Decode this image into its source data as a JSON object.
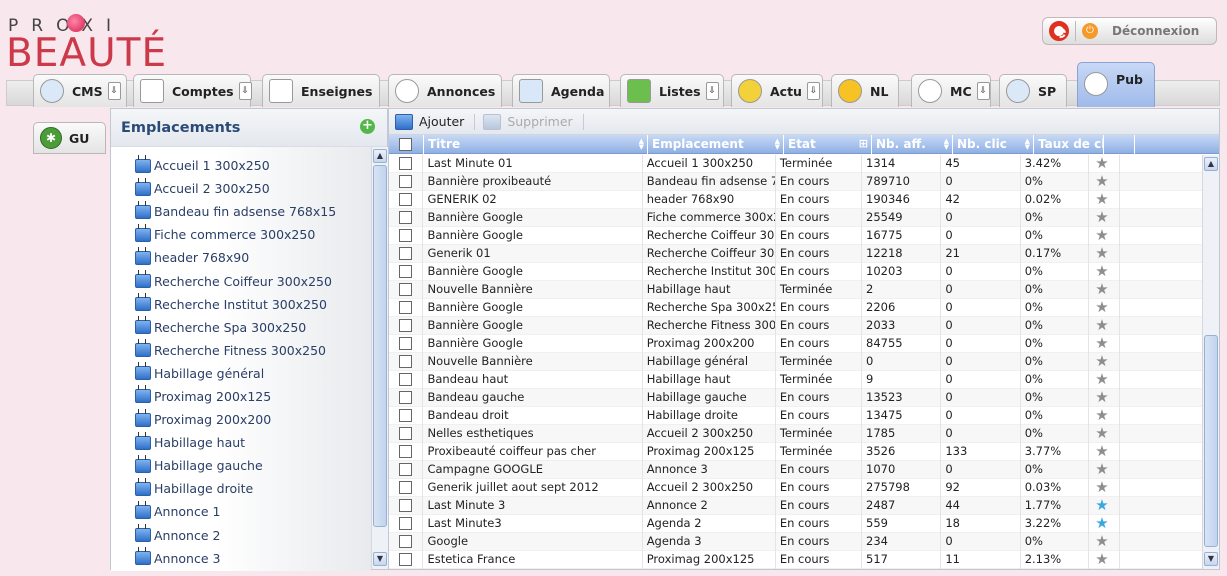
{
  "brand": {
    "top": "PROXI",
    "bottom": "BEAUTÉ"
  },
  "logout": {
    "label": "Déconnexion"
  },
  "tabs": [
    {
      "label": "CMS",
      "icon": "gauge-icon",
      "dropdown": true
    },
    {
      "label": "Comptes",
      "icon": "users-icon",
      "dropdown": true
    },
    {
      "label": "Enseignes",
      "icon": "home-icon",
      "dropdown": false
    },
    {
      "label": "Annonces",
      "icon": "speech-bubble-icon",
      "dropdown": false
    },
    {
      "label": "Agenda",
      "icon": "calendar-icon",
      "dropdown": false
    },
    {
      "label": "Listes",
      "icon": "list-icon",
      "dropdown": true
    },
    {
      "label": "Actu",
      "icon": "info-icon",
      "dropdown": true
    },
    {
      "label": "NL",
      "icon": "envelope-icon",
      "dropdown": false
    },
    {
      "label": "MC",
      "icon": "camera-icon",
      "dropdown": true
    },
    {
      "label": "SP",
      "icon": "gauge-icon",
      "dropdown": false
    },
    {
      "label": "Pub",
      "icon": "wand-icon",
      "dropdown": false
    }
  ],
  "side_tab": {
    "label": "GU"
  },
  "left_panel": {
    "title": "Emplacements",
    "items": [
      "Accueil 1 300x250",
      "Accueil 2 300x250",
      "Bandeau fin adsense 768x15",
      "Fiche commerce 300x250",
      "header 768x90",
      "Recherche Coiffeur 300x250",
      "Recherche Institut 300x250",
      "Recherche Spa 300x250",
      "Recherche Fitness 300x250",
      "Habillage général",
      "Proximag 200x125",
      "Proximag 200x200",
      "Habillage haut",
      "Habillage gauche",
      "Habillage droite",
      "Annonce 1",
      "Annonce 2",
      "Annonce 3"
    ]
  },
  "toolbar": {
    "add_label": "Ajouter",
    "delete_label": "Supprimer"
  },
  "grid": {
    "columns": [
      "Titre",
      "Emplacement",
      "Etat",
      "Nb. aff.",
      "Nb. clic",
      "Taux de cl"
    ],
    "rows": [
      {
        "titre": "Last Minute 01",
        "emplacement": "Accueil 1 300x250",
        "etat": "Terminée",
        "aff": "1314",
        "clic": "45",
        "taux": "3.42%",
        "starred": false
      },
      {
        "titre": "Bannière proxibeauté",
        "emplacement": "Bandeau fin adsense 76",
        "etat": "En cours",
        "aff": "789710",
        "clic": "0",
        "taux": "0%",
        "starred": false
      },
      {
        "titre": "GENERIK 02",
        "emplacement": "header 768x90",
        "etat": "En cours",
        "aff": "190346",
        "clic": "42",
        "taux": "0.02%",
        "starred": false
      },
      {
        "titre": "Bannière Google",
        "emplacement": "Fiche commerce 300x2",
        "etat": "En cours",
        "aff": "25549",
        "clic": "0",
        "taux": "0%",
        "starred": false
      },
      {
        "titre": "Bannière Google",
        "emplacement": "Recherche Coiffeur 300",
        "etat": "En cours",
        "aff": "16775",
        "clic": "0",
        "taux": "0%",
        "starred": false
      },
      {
        "titre": "Generik 01",
        "emplacement": "Recherche Coiffeur 300",
        "etat": "En cours",
        "aff": "12218",
        "clic": "21",
        "taux": "0.17%",
        "starred": false
      },
      {
        "titre": "Bannière Google",
        "emplacement": "Recherche Institut 300x",
        "etat": "En cours",
        "aff": "10203",
        "clic": "0",
        "taux": "0%",
        "starred": false
      },
      {
        "titre": "Nouvelle Bannière",
        "emplacement": "Habillage haut",
        "etat": "Terminée",
        "aff": "2",
        "clic": "0",
        "taux": "0%",
        "starred": false
      },
      {
        "titre": "Bannière Google",
        "emplacement": "Recherche Spa 300x25",
        "etat": "En cours",
        "aff": "2206",
        "clic": "0",
        "taux": "0%",
        "starred": false
      },
      {
        "titre": "Bannière Google",
        "emplacement": "Recherche Fitness 300x",
        "etat": "En cours",
        "aff": "2033",
        "clic": "0",
        "taux": "0%",
        "starred": false
      },
      {
        "titre": "Bannière Google",
        "emplacement": "Proximag 200x200",
        "etat": "En cours",
        "aff": "84755",
        "clic": "0",
        "taux": "0%",
        "starred": false
      },
      {
        "titre": "Nouvelle Bannière",
        "emplacement": "Habillage général",
        "etat": "Terminée",
        "aff": "0",
        "clic": "0",
        "taux": "0%",
        "starred": false
      },
      {
        "titre": "Bandeau haut",
        "emplacement": "Habillage haut",
        "etat": "Terminée",
        "aff": "9",
        "clic": "0",
        "taux": "0%",
        "starred": false
      },
      {
        "titre": "Bandeau gauche",
        "emplacement": "Habillage gauche",
        "etat": "En cours",
        "aff": "13523",
        "clic": "0",
        "taux": "0%",
        "starred": false
      },
      {
        "titre": "Bandeau droit",
        "emplacement": "Habillage droite",
        "etat": "En cours",
        "aff": "13475",
        "clic": "0",
        "taux": "0%",
        "starred": false
      },
      {
        "titre": "Nelles esthetiques",
        "emplacement": "Accueil 2 300x250",
        "etat": "Terminée",
        "aff": "1785",
        "clic": "0",
        "taux": "0%",
        "starred": false
      },
      {
        "titre": "Proxibeauté coiffeur pas cher",
        "emplacement": "Proximag 200x125",
        "etat": "Terminée",
        "aff": "3526",
        "clic": "133",
        "taux": "3.77%",
        "starred": false
      },
      {
        "titre": "Campagne GOOGLE",
        "emplacement": "Annonce 3",
        "etat": "En cours",
        "aff": "1070",
        "clic": "0",
        "taux": "0%",
        "starred": false
      },
      {
        "titre": "Generik juillet aout sept 2012",
        "emplacement": "Accueil 2 300x250",
        "etat": "En cours",
        "aff": "275798",
        "clic": "92",
        "taux": "0.03%",
        "starred": false
      },
      {
        "titre": "Last Minute 3",
        "emplacement": "Annonce 2",
        "etat": "En cours",
        "aff": "2487",
        "clic": "44",
        "taux": "1.77%",
        "starred": true
      },
      {
        "titre": "Last Minute3",
        "emplacement": "Agenda 2",
        "etat": "En cours",
        "aff": "559",
        "clic": "18",
        "taux": "3.22%",
        "starred": true
      },
      {
        "titre": "Google",
        "emplacement": "Agenda 3",
        "etat": "En cours",
        "aff": "234",
        "clic": "0",
        "taux": "0%",
        "starred": false
      },
      {
        "titre": "Estetica France",
        "emplacement": "Proximag 200x125",
        "etat": "En cours",
        "aff": "517",
        "clic": "11",
        "taux": "2.13%",
        "starred": false
      }
    ]
  },
  "colors": {
    "accent": "#9fbaea",
    "brand": "#cc3a4a",
    "background": "#f8e8ee",
    "star_on": "#3aa8e0"
  }
}
